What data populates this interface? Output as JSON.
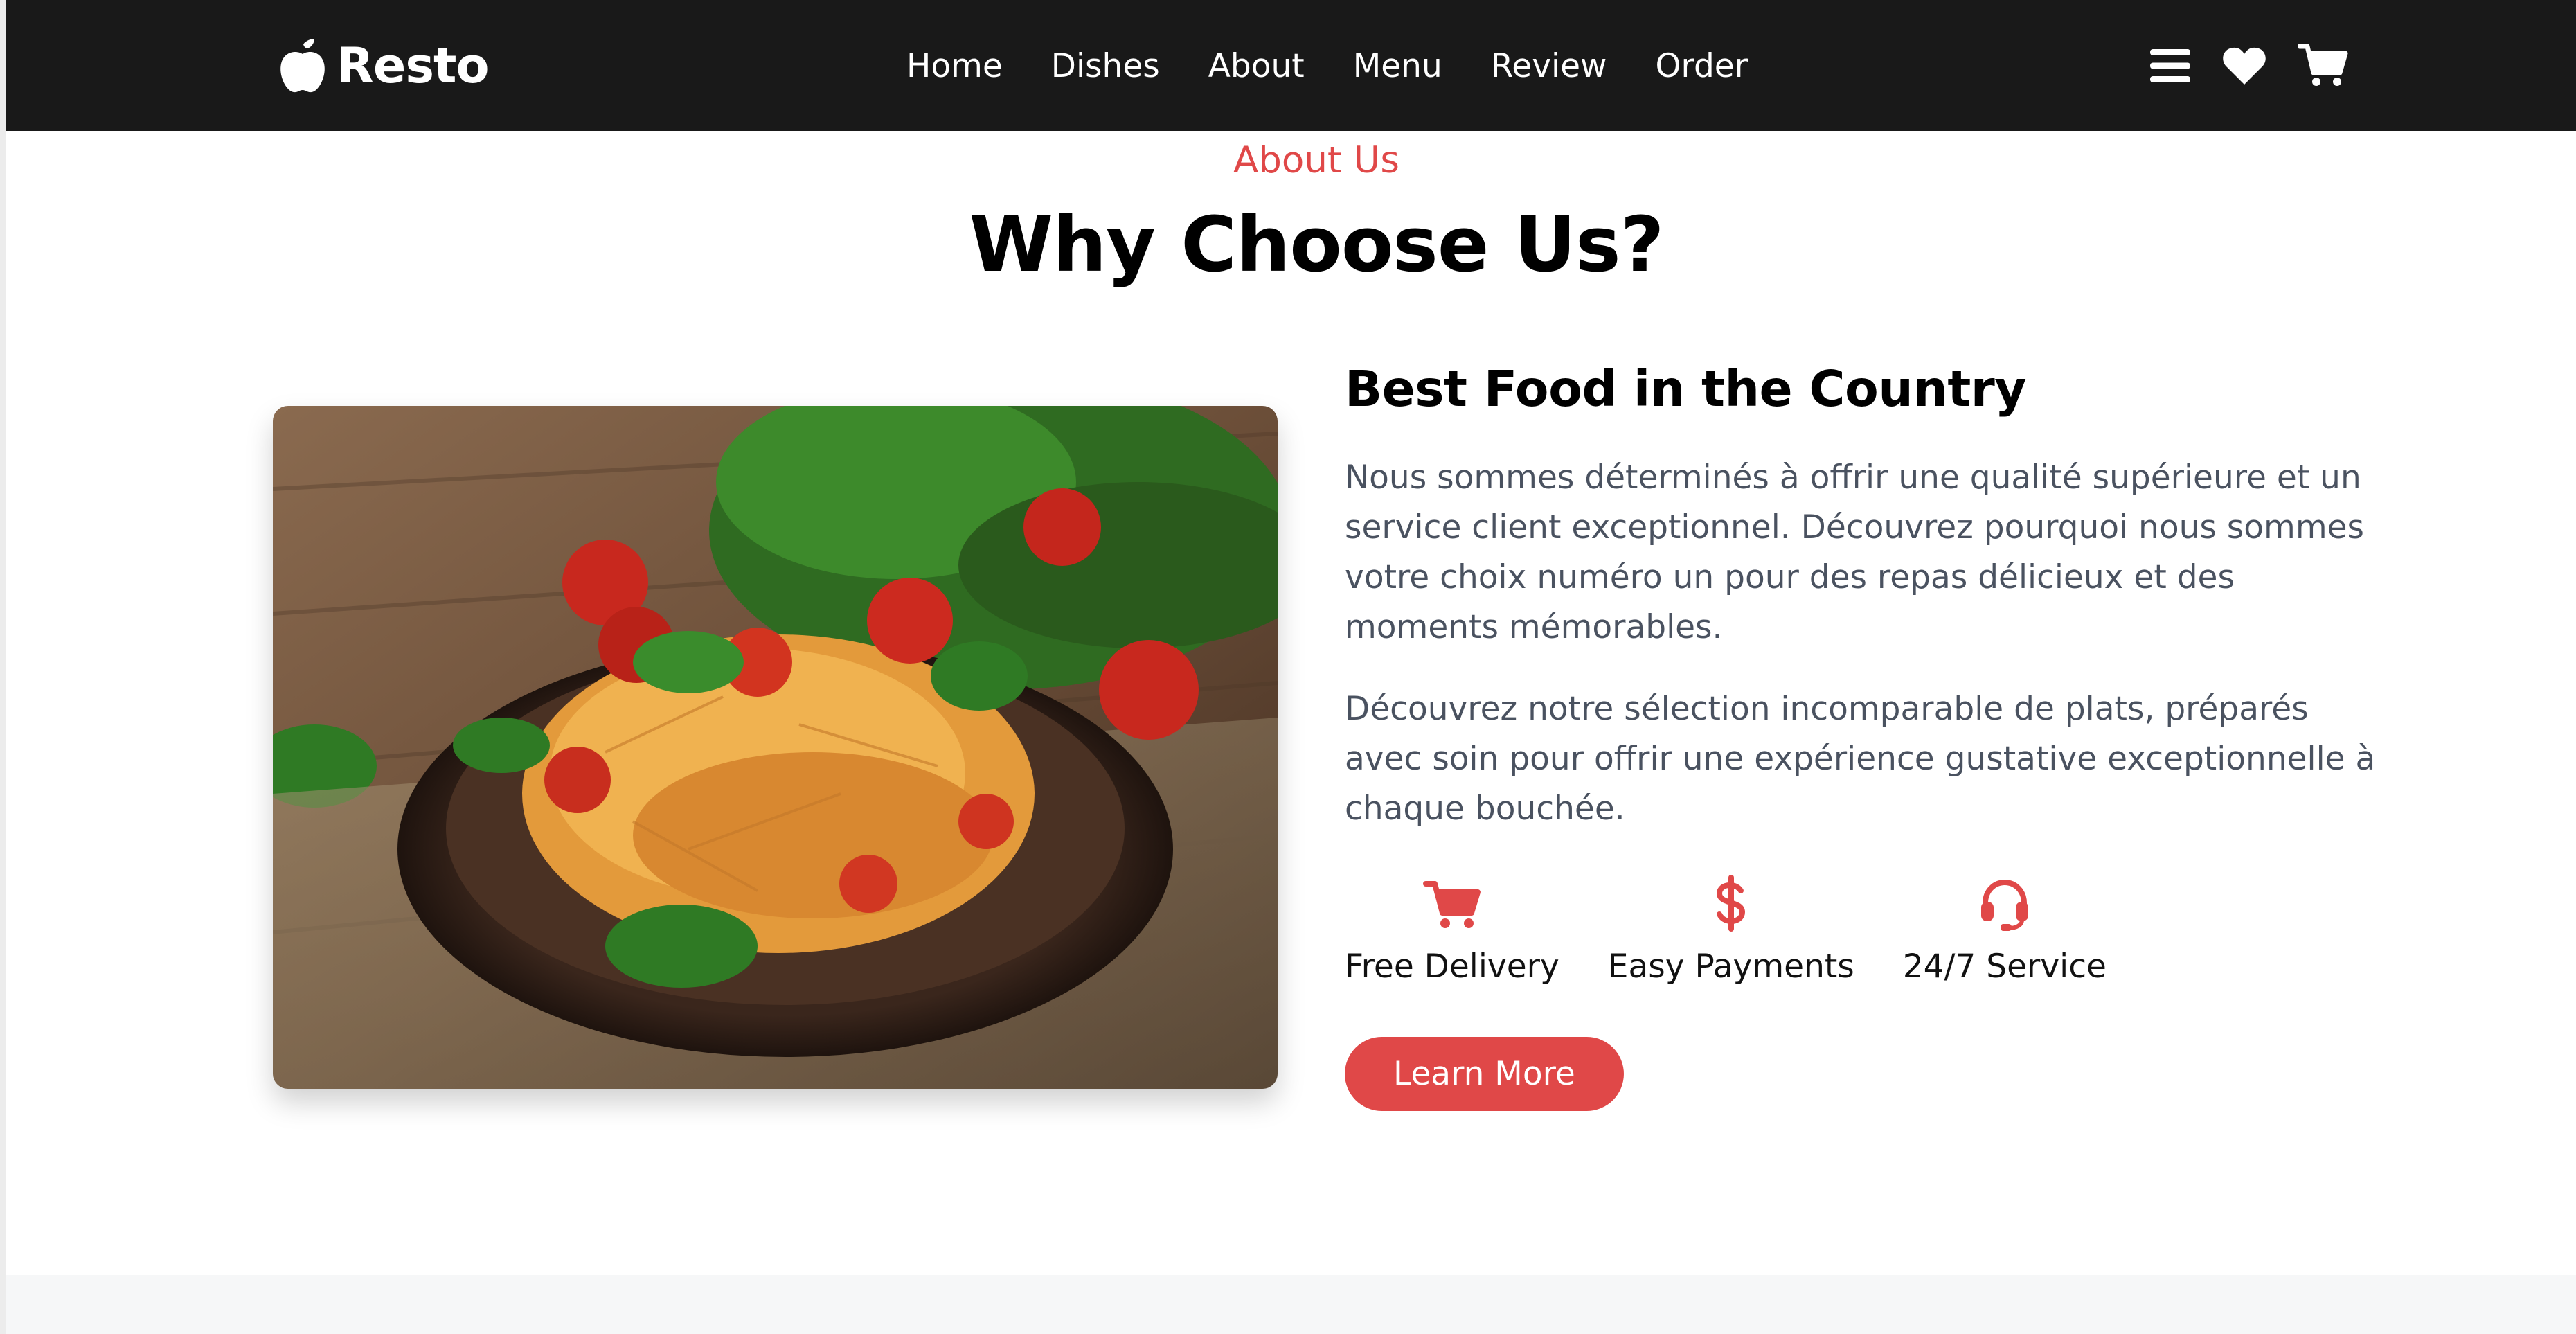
{
  "navbar": {
    "brand": "Resto",
    "links": [
      "Home",
      "Dishes",
      "About",
      "Menu",
      "Review",
      "Order"
    ],
    "icons": [
      "menu-icon",
      "heart-icon",
      "cart-icon"
    ]
  },
  "about": {
    "eyebrow": "About Us",
    "title": "Why Choose Us?",
    "heading": "Best Food in the Country",
    "paragraphs": [
      "Nous sommes déterminés à offrir une qualité supérieure et un service client exceptionnel. Découvrez pourquoi nous sommes votre choix numéro un pour des repas délicieux et des moments mémorables.",
      "Découvrez notre sélection incomparable de plats, préparés avec soin pour offrir une expérience gustative exceptionnelle à chaque bouchée."
    ],
    "features": [
      {
        "icon": "cart-icon",
        "label": "Free Delivery"
      },
      {
        "icon": "dollar-icon",
        "label": "Easy Payments"
      },
      {
        "icon": "headset-icon",
        "label": "24/7 Service"
      }
    ],
    "button": "Learn More"
  },
  "colors": {
    "accent": "#e04848",
    "navbar": "#191919",
    "text_muted": "#4a5260"
  }
}
